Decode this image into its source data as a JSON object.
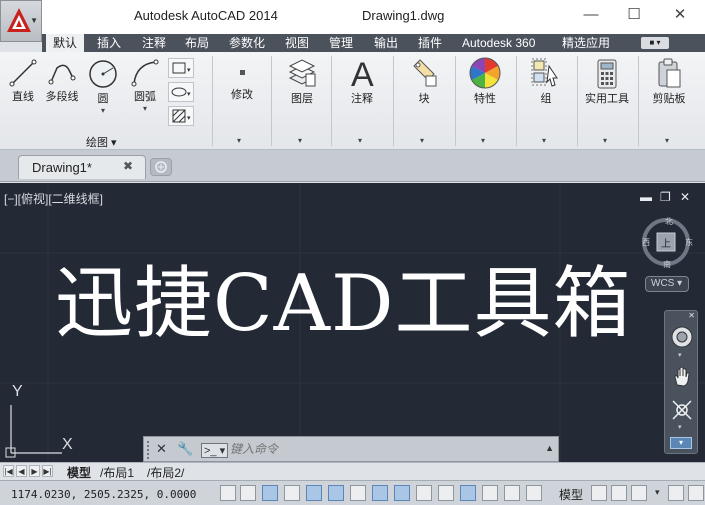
{
  "window": {
    "app_title": "Autodesk AutoCAD 2014",
    "file_title": "Drawing1.dwg"
  },
  "ribbon_tabs": [
    "默认",
    "插入",
    "注释",
    "布局",
    "参数化",
    "视图",
    "管理",
    "输出",
    "插件",
    "Autodesk 360",
    "精选应用"
  ],
  "ribbon": {
    "draw_tools": [
      "直线",
      "多段线",
      "圆",
      "圆弧"
    ],
    "draw_panel_title": "绘图",
    "panels": [
      "修改",
      "图层",
      "注释",
      "块",
      "特性",
      "组",
      "实用工具",
      "剪贴板"
    ]
  },
  "document": {
    "tab_label": "Drawing1*",
    "tab_close": "✖"
  },
  "viewport": {
    "label": "[−][俯视][二维线框]",
    "big_text": "迅捷CAD工具箱",
    "viewcube": {
      "north": "北",
      "south": "南",
      "west": "西",
      "east": "东",
      "face": "上"
    },
    "wcs_label": "WCS",
    "ucs_y": "Y",
    "ucs_x": "X"
  },
  "command_line": {
    "placeholder": "键入命令"
  },
  "layout_tabs": [
    "模型",
    "布局1",
    "布局2"
  ],
  "status": {
    "coordinates": "1174.0230, 2505.2325, 0.0000",
    "model_label": "模型"
  },
  "colors": {
    "canvas": "#232a35",
    "tab_bar": "#4b525c",
    "accent_red": "#c8211e"
  }
}
